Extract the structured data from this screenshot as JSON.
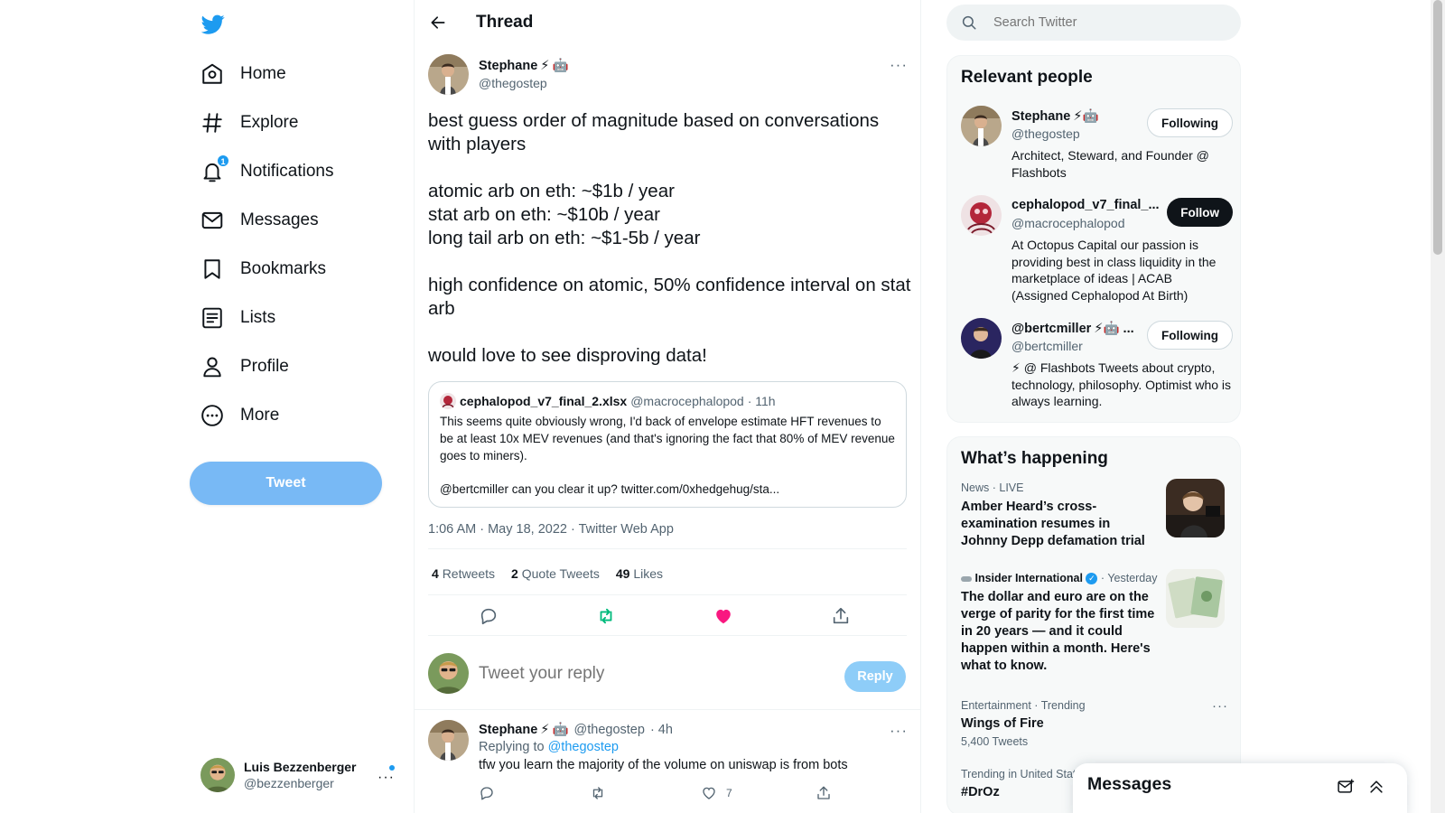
{
  "nav": {
    "logo": "twitter-bird-icon",
    "items": [
      {
        "label": "Home",
        "icon": "home-icon"
      },
      {
        "label": "Explore",
        "icon": "hash-icon"
      },
      {
        "label": "Notifications",
        "icon": "bell-icon",
        "badge": "1"
      },
      {
        "label": "Messages",
        "icon": "mail-icon"
      },
      {
        "label": "Bookmarks",
        "icon": "bookmark-icon"
      },
      {
        "label": "Lists",
        "icon": "list-icon"
      },
      {
        "label": "Profile",
        "icon": "person-icon"
      },
      {
        "label": "More",
        "icon": "more-circle-icon"
      }
    ],
    "tweet_button": "Tweet"
  },
  "account": {
    "name": "Luis Bezzenberger",
    "handle": "@bezzenberger",
    "more": "···"
  },
  "thread": {
    "title": "Thread",
    "author": {
      "name": "Stephane",
      "handle": "@thegostep",
      "emoji": [
        "⚡",
        "🤖"
      ]
    },
    "more": "···",
    "text": [
      "best guess order of magnitude based on conversations with players",
      "",
      "atomic arb on eth: ~$1b / year",
      "stat arb on eth: ~$10b / year",
      "long tail arb on eth: ~$1-5b / year",
      "",
      "high confidence on atomic, 50% confidence interval on stat arb",
      "",
      "would love to see disproving data!"
    ],
    "quote": {
      "name": "cephalopod_v7_final_2.xlsx",
      "handle": "@macrocephalopod",
      "time": "· 11h",
      "body": "This seems quite obviously wrong, I'd back of envelope estimate HFT revenues to be at least 10x MEV revenues (and that's ignoring the fact that 80% of MEV revenue goes to miners).",
      "body2": "@bertcmiller can you clear it up? twitter.com/0xhedgehug/sta..."
    },
    "timestamp": "1:06 AM · May 18, 2022 · Twitter Web App",
    "stats": {
      "retweets": "4",
      "retweets_label": "Retweets",
      "quotes": "2",
      "quotes_label": "Quote Tweets",
      "likes": "49",
      "likes_label": "Likes"
    },
    "reply_placeholder": "Tweet your reply",
    "reply_button": "Reply",
    "reply": {
      "name": "Stephane",
      "handle": "@thegostep",
      "time": "· 4h",
      "replying_prefix": "Replying to",
      "replying_to": "@thegostep",
      "text": "tfw you learn the majority of the volume on uniswap is from bots",
      "likes": "7",
      "more": "···"
    }
  },
  "search": {
    "placeholder": "Search Twitter"
  },
  "relevant": {
    "title": "Relevant people",
    "people": [
      {
        "name": "Stephane",
        "emoji": "⚡🤖",
        "handle": "@thegostep",
        "bio": "Architect, Steward, and Founder @ Flashbots",
        "button": "Following"
      },
      {
        "name": "cephalopod_v7_final_...",
        "emoji": "",
        "handle": "@macrocephalopod",
        "bio": "At Octopus Capital our passion is providing best in class liquidity in the marketplace of ideas | ACAB (Assigned Cephalopod At Birth)",
        "button": "Follow"
      },
      {
        "name": "@bertcmiller",
        "emoji": "⚡🤖 ...",
        "handle": "@bertcmiller",
        "bio": "⚡ @ Flashbots Tweets about crypto, technology, philosophy. Optimist who is always learning.",
        "button": "Following"
      }
    ]
  },
  "happening": {
    "title": "What’s happening",
    "trends": [
      {
        "meta": "News · LIVE",
        "title": "Amber Heard’s cross-examination resumes in Johnny Depp defamation trial"
      },
      {
        "meta_source": "Insider International",
        "meta_time": "· Yesterday",
        "title": "The dollar and euro are on the verge of parity for the first time in 20 years — and it could happen within a month. Here's what to know."
      },
      {
        "meta": "Entertainment · Trending",
        "title": "Wings of Fire",
        "sub": "5,400 Tweets",
        "more": "···"
      },
      {
        "meta": "Trending in United States",
        "title": "#DrOz"
      }
    ]
  },
  "messages_drawer": {
    "title": "Messages"
  },
  "colors": {
    "accent": "#1d9bf0",
    "like": "#f91880",
    "retweet": "#00ba7c",
    "tweet_button": "#78b9f5"
  }
}
